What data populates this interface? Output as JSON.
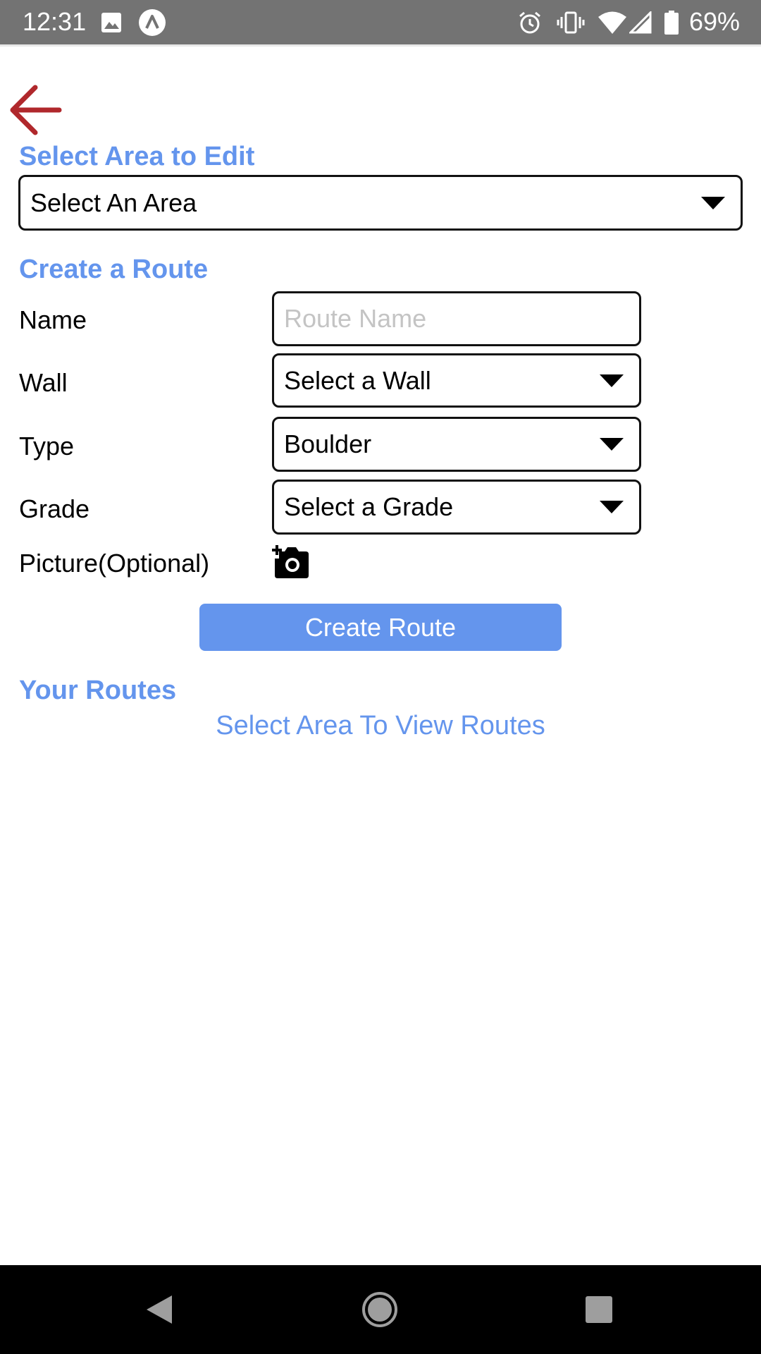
{
  "status_bar": {
    "time": "12:31",
    "battery": "69%",
    "icons": [
      "image-icon",
      "app-notification-icon",
      "alarm-icon",
      "vibrate-icon",
      "wifi-icon",
      "signal-icon",
      "battery-icon"
    ]
  },
  "header": {
    "back_icon": "arrow-left-icon",
    "back_color": "#b0282c"
  },
  "area_section": {
    "title": "Select Area to Edit",
    "select_value": "Select An Area"
  },
  "create_section": {
    "title": "Create a Route",
    "fields": {
      "name_label": "Name",
      "name_placeholder": "Route Name",
      "name_value": "",
      "wall_label": "Wall",
      "wall_value": "Select a Wall",
      "type_label": "Type",
      "type_value": "Boulder",
      "grade_label": "Grade",
      "grade_value": "Select a Grade",
      "picture_label": "Picture(Optional)",
      "picture_icon": "add-photo-camera-icon"
    },
    "submit_label": "Create Route"
  },
  "routes_section": {
    "title": "Your Routes",
    "empty_message": "Select Area To View Routes"
  },
  "nav_bar": {
    "icons": [
      "back-triangle-icon",
      "home-circle-icon",
      "recents-square-icon"
    ]
  },
  "colors": {
    "accent": "#6495ed",
    "status_bar": "#737373",
    "nav_bar": "#000000"
  }
}
